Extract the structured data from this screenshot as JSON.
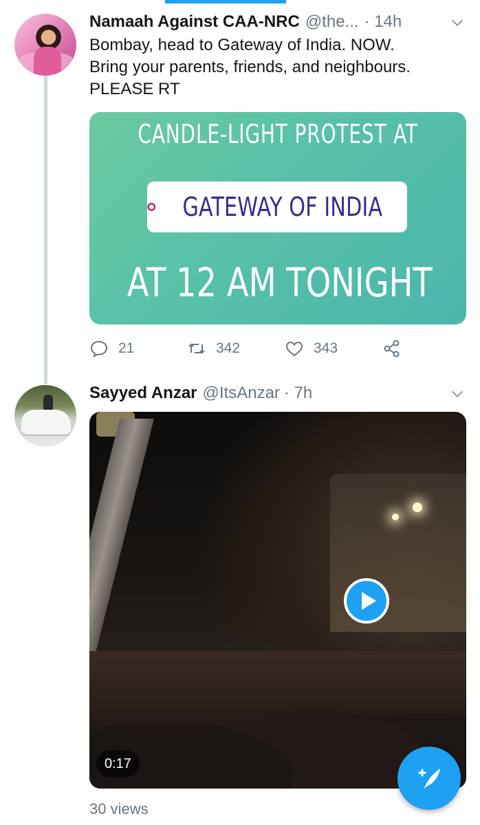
{
  "tweets": [
    {
      "name": "Namaah Against CAA-NRC",
      "handle": "@the...",
      "time": "· 14h",
      "text_lines": [
        "Bombay, head to Gateway of India. NOW.",
        "Bring your parents, friends, and neighbours.",
        "PLEASE RT"
      ],
      "card": {
        "line1": "CANDLE-LIGHT PROTEST AT",
        "location": "GATEWAY OF INDIA",
        "line3": "AT 12 AM TONIGHT"
      },
      "replies": "21",
      "retweets": "342",
      "likes": "343"
    },
    {
      "name": "Sayyed Anzar",
      "handle": "@ItsAnzar",
      "time": "· 7h",
      "video_duration": "0:17",
      "views": "30 views"
    }
  ],
  "icons": {
    "reply": "reply-icon",
    "retweet": "retweet-icon",
    "like": "like-icon",
    "share": "share-icon",
    "play": "play-icon",
    "compose": "compose-icon",
    "chevron": "chevron-down-icon"
  },
  "colors": {
    "accent": "#1da1f2",
    "muted": "#657786",
    "card_green": "#57c1a8",
    "pill_text": "#3d2b8e"
  }
}
